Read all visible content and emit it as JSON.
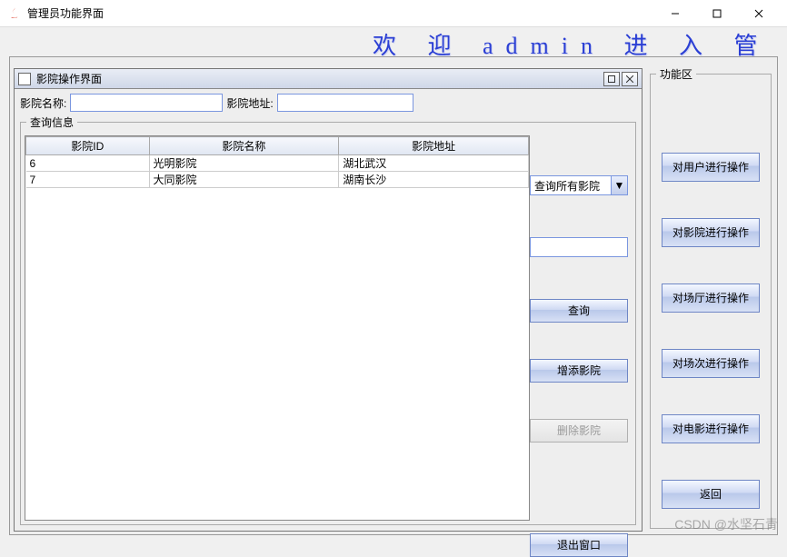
{
  "window": {
    "title": "管理员功能界面"
  },
  "banner": "欢 迎 admin 进 入 管 理 员",
  "internal": {
    "title": "影院操作界面",
    "name_label": "影院名称:",
    "addr_label": "影院地址:",
    "name_value": "",
    "addr_value": "",
    "query_legend": "查询信息",
    "columns": [
      "影院ID",
      "影院名称",
      "影院地址"
    ],
    "rows": [
      {
        "id": "6",
        "name": "光明影院",
        "addr": "湖北武汉"
      },
      {
        "id": "7",
        "name": "大同影院",
        "addr": "湖南长沙"
      }
    ],
    "combo": {
      "selected": "查询所有影院"
    },
    "buttons": {
      "query": "查询",
      "add": "增添影院",
      "delete": "删除影院",
      "exit": "退出窗口"
    }
  },
  "funcs": {
    "legend": "功能区",
    "items": [
      "对用户进行操作",
      "对影院进行操作",
      "对场厅进行操作",
      "对场次进行操作",
      "对电影进行操作",
      "返回"
    ]
  },
  "watermark": "CSDN @水坚石青"
}
